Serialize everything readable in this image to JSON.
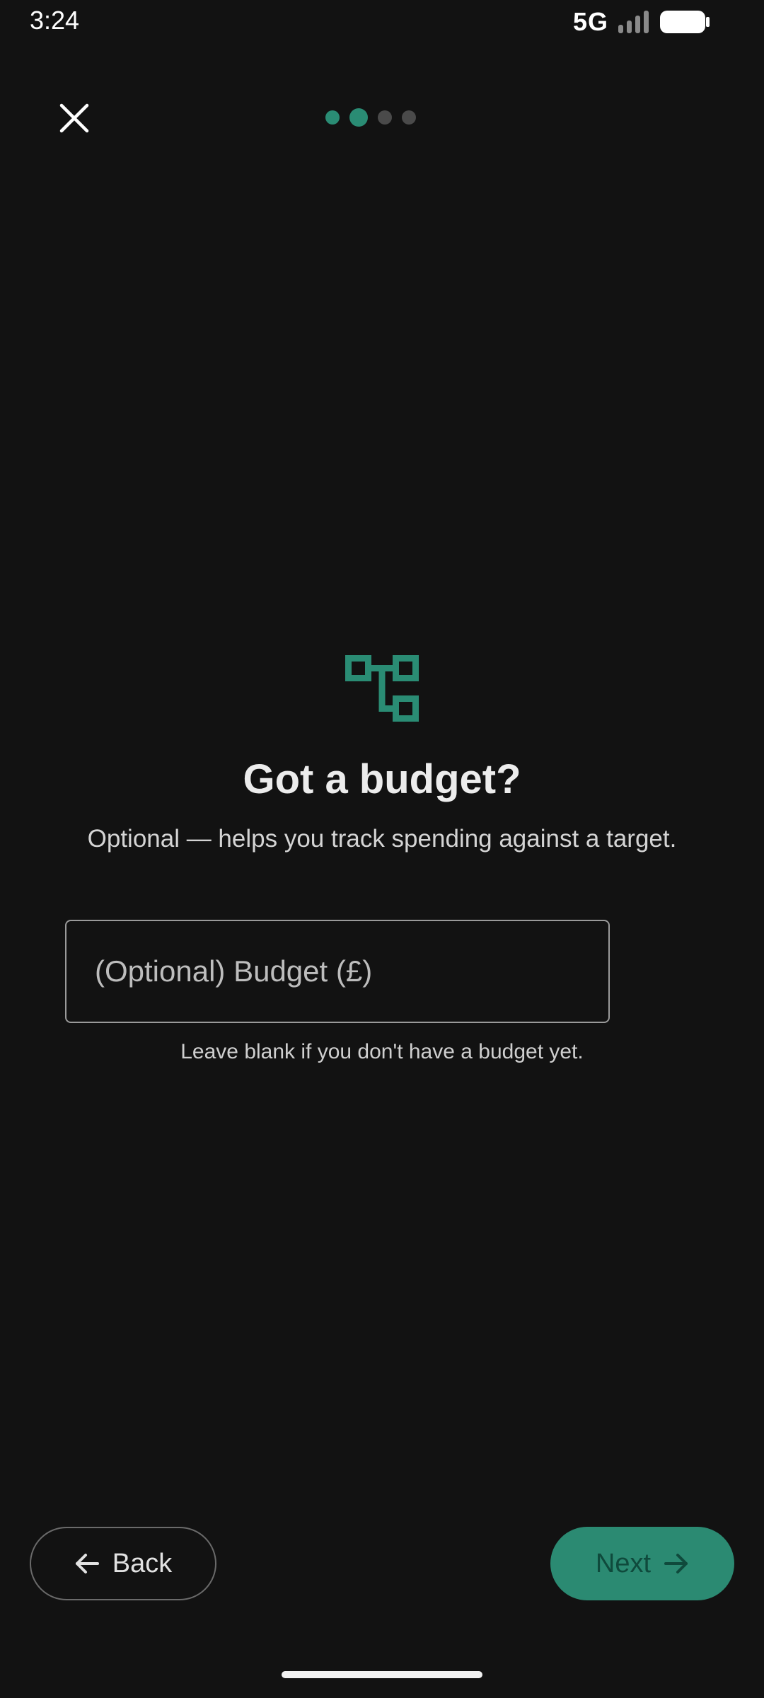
{
  "status_bar": {
    "time": "3:24",
    "network": "5G",
    "icons": [
      "signal-icon",
      "battery-icon"
    ]
  },
  "header": {
    "close_icon": "close-icon",
    "progress": {
      "total_steps": 4,
      "current_step": 2
    }
  },
  "main": {
    "hero_icon": "budget-tree-icon",
    "title": "Got a budget?",
    "subtitle": "Optional — helps you track spending against a target.",
    "budget_field": {
      "value": "",
      "placeholder": "(Optional) Budget (£)"
    },
    "helper_text": "Leave blank if you don't have a budget yet."
  },
  "footer": {
    "back_label": "Back",
    "next_label": "Next"
  },
  "colors": {
    "background": "#121212",
    "accent": "#2b8a72",
    "next_text": "#0f4a3c",
    "inactive_dot": "#4a4a4a"
  }
}
